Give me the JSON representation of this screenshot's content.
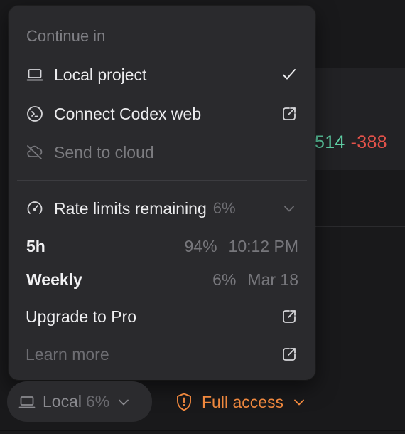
{
  "background": {
    "diff_added": "514",
    "diff_removed": "-388"
  },
  "menu": {
    "section_label": "Continue in",
    "items": [
      {
        "label": "Local project",
        "icon": "laptop-icon",
        "trailing": "checkmark-icon",
        "enabled": true
      },
      {
        "label": "Connect Codex web",
        "icon": "terminal-circle-icon",
        "trailing": "external-link-icon",
        "enabled": true
      },
      {
        "label": "Send to cloud",
        "icon": "cloud-off-icon",
        "trailing": "",
        "enabled": false
      }
    ],
    "rate_limits": {
      "label": "Rate limits remaining",
      "percent": "6%",
      "icon": "gauge-icon",
      "trailing": "chevron-down-icon",
      "rows": [
        {
          "name": "5h",
          "percent": "94%",
          "reset": "10:12 PM"
        },
        {
          "name": "Weekly",
          "percent": "6%",
          "reset": "Mar 18"
        }
      ]
    },
    "upgrade": {
      "label": "Upgrade to Pro",
      "trailing": "external-link-icon"
    },
    "learn_more": {
      "label": "Learn more",
      "trailing": "external-link-icon"
    }
  },
  "footer": {
    "local_label": "Local",
    "local_percent": "6%",
    "access_label": "Full access"
  },
  "colors": {
    "accent_orange": "#f0883e",
    "diff_green": "#5fcfa5",
    "diff_red": "#e5534b"
  }
}
